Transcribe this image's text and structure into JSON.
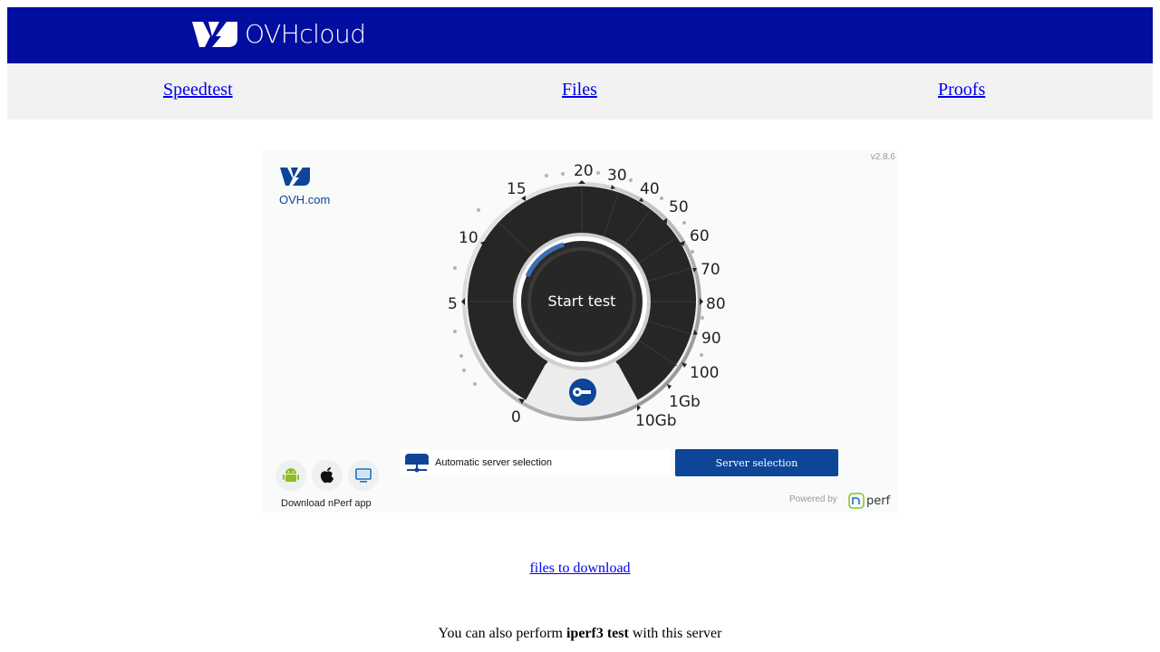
{
  "header": {
    "brand": "OVHcloud",
    "background": "#020ea0"
  },
  "nav": {
    "items": [
      {
        "label": "Speedtest"
      },
      {
        "label": "Files"
      },
      {
        "label": "Proofs"
      }
    ]
  },
  "speedtest": {
    "version": "v2.8.6",
    "logo_text": "OVH.com",
    "start_label": "Start test",
    "scale_labels": [
      "0",
      "5",
      "10",
      "15",
      "20",
      "30",
      "40",
      "50",
      "60",
      "70",
      "80",
      "90",
      "100",
      "1Gb",
      "10Gb"
    ],
    "server_selection_label": "Automatic server selection",
    "server_button_label": "Server selection",
    "download_label": "Download nPerf app",
    "apps": [
      "android-icon",
      "apple-icon",
      "desktop-icon"
    ],
    "powered_by": "Powered by",
    "nperf_brand": "perf",
    "accent": "#0d4597"
  },
  "links": {
    "files": "files to download"
  },
  "iperf": {
    "prefix": "You can also perform ",
    "bold": "iperf3 test",
    "suffix": " with this server"
  }
}
